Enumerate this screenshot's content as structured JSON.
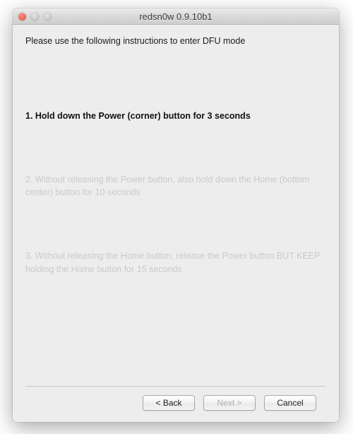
{
  "window": {
    "title": "redsn0w 0.9.10b1"
  },
  "content": {
    "intro": "Please use the following instructions to enter DFU mode",
    "steps": [
      {
        "text": "1. Hold down the Power (corner) button for 3 seconds",
        "active": true
      },
      {
        "text": "2. Without releasing the Power button, also hold down the Home (bottom center) button for 10 seconds",
        "active": false
      },
      {
        "text": "3. Without releasing the Home button, release the Power button BUT KEEP holding the Home button for 15 seconds",
        "active": false
      }
    ]
  },
  "buttons": {
    "back": "< Back",
    "next": "Next >",
    "cancel": "Cancel"
  }
}
